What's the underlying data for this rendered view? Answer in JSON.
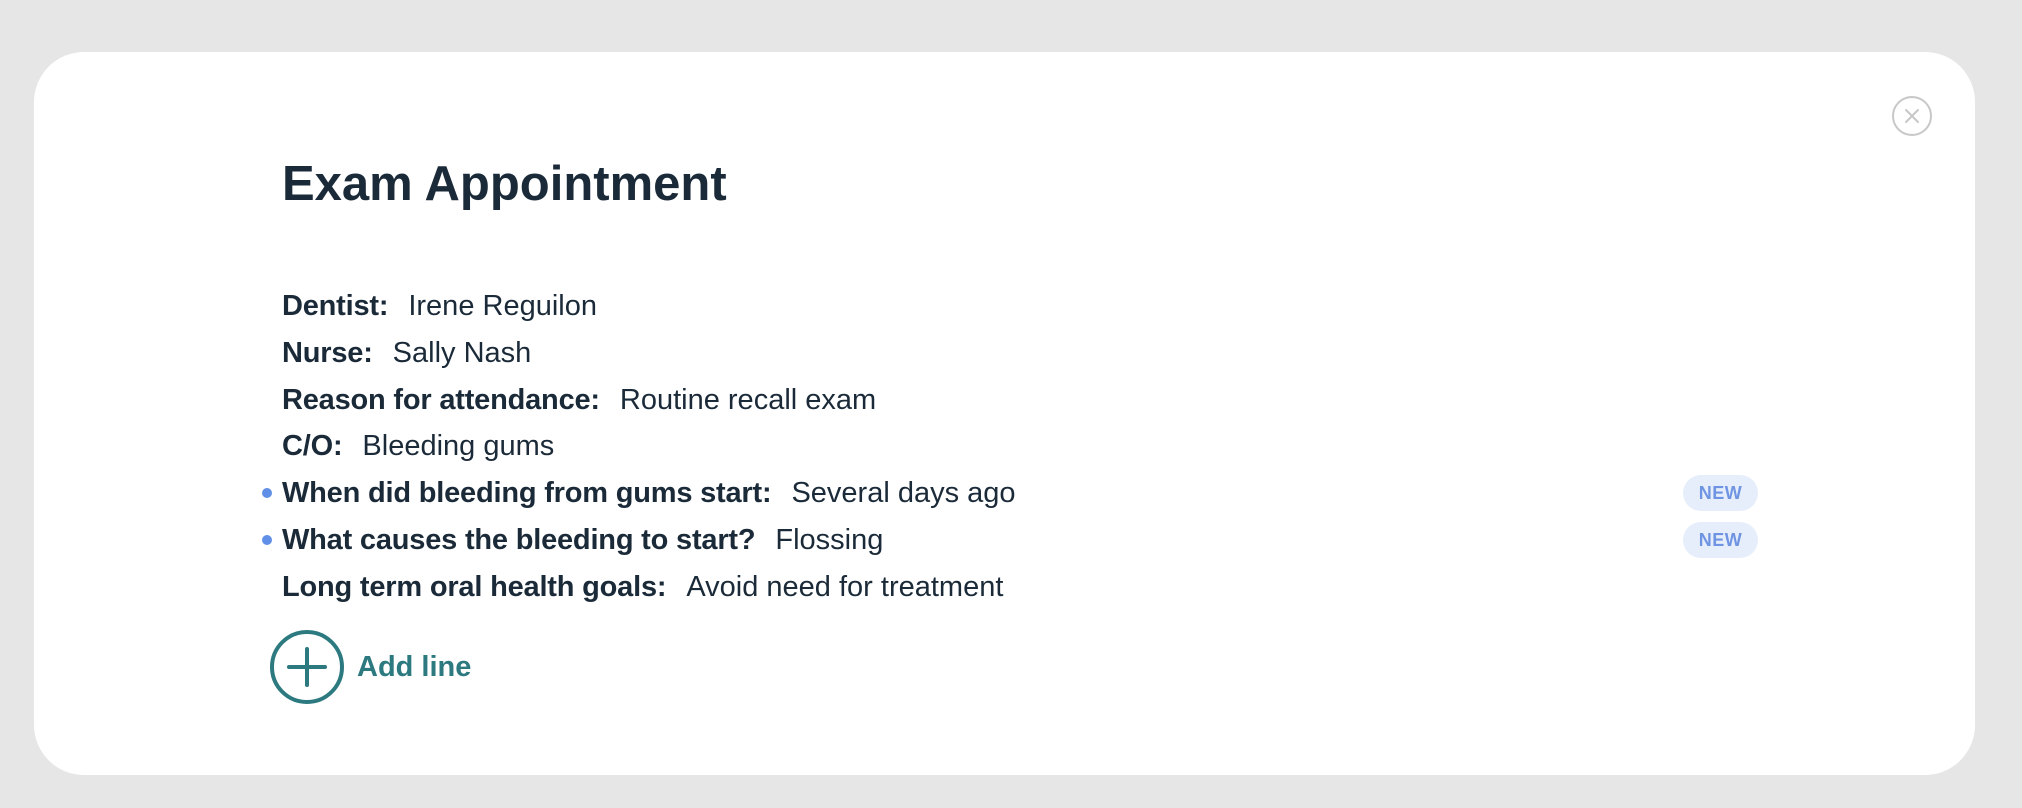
{
  "dialog": {
    "title": "Exam Appointment",
    "close_icon": "close-icon"
  },
  "lines": [
    {
      "label": "Dentist:",
      "value": "Irene Reguilon",
      "is_new": false
    },
    {
      "label": "Nurse:",
      "value": "Sally Nash",
      "is_new": false
    },
    {
      "label": "Reason for attendance:",
      "value": "Routine recall exam",
      "is_new": false
    },
    {
      "label": "C/O:",
      "value": "Bleeding gums",
      "is_new": false
    },
    {
      "label": "When did bleeding from gums start:",
      "value": "Several days ago",
      "is_new": true,
      "badge": "NEW"
    },
    {
      "label": "What causes the bleeding to start?",
      "value": "Flossing",
      "is_new": true,
      "badge": "NEW"
    },
    {
      "label": "Long term oral health goals:",
      "value": "Avoid need for treatment",
      "is_new": false
    }
  ],
  "add_line": {
    "label": "Add line",
    "icon": "plus-circle-icon"
  },
  "colors": {
    "background": "#e6e6e6",
    "card": "#ffffff",
    "text": "#1b2a38",
    "accent_teal": "#2c7a80",
    "new_badge_bg": "#e6eefb",
    "new_badge_text": "#6f95e2",
    "new_dot": "#5f8fe6",
    "close_border": "#c8c8c8"
  }
}
